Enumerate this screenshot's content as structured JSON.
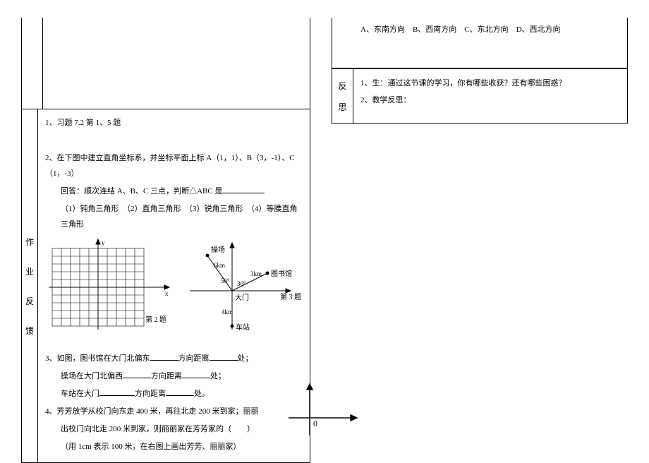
{
  "sideLabels": {
    "homework": {
      "c1": "作",
      "c2": "业",
      "c3": "反",
      "c4": "馈"
    },
    "reflect": {
      "c1": "反",
      "c2": "思"
    }
  },
  "left": {
    "q1": "1、习题 7.2 第 1、5 题",
    "q2a": "2、在下图中建立直角坐标系，并坐标平面上标 A（1，1）、B（3，-1）、C（1，-3）",
    "q2b": "回答：顺次连结 A、B、C 三点，判断△ABC 是",
    "q2opts": "（1）钝角三角形　（2）直角三角形　（3）锐角三角形　（4）等腰直角三角形",
    "q3a": "3、如图，图书馆在大门北偏东",
    "q3a2": "方向距离",
    "q3a3": "处；",
    "q3b": "操场在大门北偏西",
    "q3b2": "方向距离",
    "q3b3": "处；",
    "q3c": "车站在大门",
    "q3c2": "方向距离",
    "q3c3": "处。",
    "q4a": "4、芳芳放学从校门向东走 400 米，再往北走 200 米到家；丽丽",
    "q4b": "出校门向北走 200 米到家，则丽丽家在芳芳家的（　　）",
    "q4c": "（用 1cm 表示 100 米，在右图上画出芳芳、丽丽家）",
    "gridCaption": "第 2 题",
    "dirCaption": "第 3 题",
    "labels": {
      "playground": "操场",
      "library": "图书馆",
      "gate": "大门",
      "station": "车站",
      "d6": "6km",
      "d3a": "3km",
      "d4": "4km",
      "a50": "50°",
      "a30": "30°",
      "x": "x",
      "y": "y",
      "zero": "0"
    }
  },
  "right": {
    "opts": "A、东南方向　B、西南方向　C、东北方向　D、西北方向",
    "r1": "1、生：通过这节课的学习，你有哪些收获？还有哪些困惑？",
    "r2": "2、教学反思："
  }
}
